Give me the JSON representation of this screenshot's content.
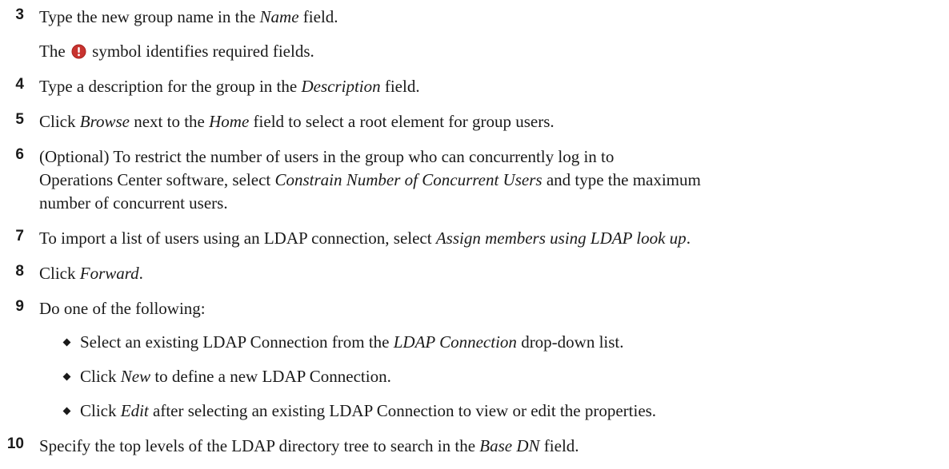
{
  "steps": [
    {
      "num": "3",
      "parts": [
        "Type the new group name in the ",
        "Name",
        " field."
      ]
    },
    {
      "note_parts": [
        "The ",
        " symbol identifies required fields."
      ],
      "note_icon": "required-field-icon"
    },
    {
      "num": "4",
      "parts": [
        "Type a description for the group in the ",
        "Description",
        " field."
      ]
    },
    {
      "num": "5",
      "parts": [
        "Click ",
        "Browse",
        " next to the ",
        "Home",
        " field to select a root element for group users."
      ]
    },
    {
      "num": "6",
      "lines": [
        [
          "(Optional) To restrict the number of users in the group who can concurrently log in to"
        ],
        [
          "Operations Center software, select ",
          "Constrain Number of Concurrent Users",
          " and type the maximum"
        ],
        [
          "number of concurrent users."
        ]
      ]
    },
    {
      "num": "7",
      "parts": [
        "To import a list of users using an LDAP connection, select ",
        "Assign members using LDAP look up",
        "."
      ]
    },
    {
      "num": "8",
      "parts": [
        "Click ",
        "Forward",
        "."
      ]
    },
    {
      "num": "9",
      "parts": [
        "Do one of the following:"
      ]
    },
    {
      "bullets": [
        [
          "Select an existing LDAP Connection from the ",
          "LDAP Connection",
          " drop-down list."
        ],
        [
          "Click ",
          "New",
          " to define a new LDAP Connection."
        ],
        [
          "Click ",
          "Edit",
          " after selecting an existing LDAP Connection to view or edit the properties."
        ]
      ]
    },
    {
      "num": "10",
      "parts": [
        "Specify the top levels of the LDAP directory tree to search in the ",
        "Base DN",
        " field."
      ]
    }
  ],
  "colors": {
    "text": "#1a1a1a",
    "required_icon": "#c8332f"
  }
}
